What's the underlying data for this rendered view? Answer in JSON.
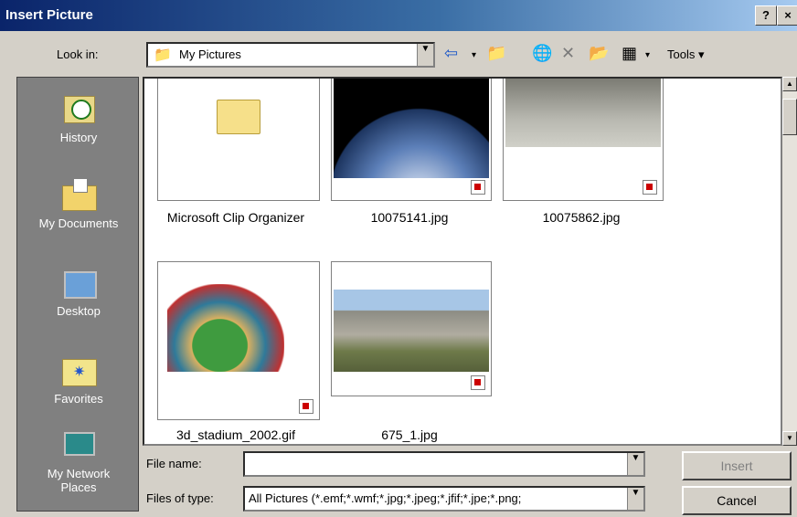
{
  "window": {
    "title": "Insert Picture",
    "help": "?",
    "close": "×"
  },
  "lookin": {
    "label": "Look in:",
    "value": "My Pictures"
  },
  "toolbar": {
    "tools_label": "Tools ▾"
  },
  "places": [
    {
      "label": "History"
    },
    {
      "label": "My Documents"
    },
    {
      "label": "Desktop"
    },
    {
      "label": "Favorites"
    },
    {
      "label": "My Network Places"
    }
  ],
  "files": [
    {
      "name": "Microsoft Clip Organizer"
    },
    {
      "name": "10075141.jpg"
    },
    {
      "name": "10075862.jpg"
    },
    {
      "name": "3d_stadium_2002.gif"
    },
    {
      "name": "675_1.jpg"
    }
  ],
  "footer": {
    "filename_label": "File name:",
    "filename_value": "",
    "filetype_label": "Files of type:",
    "filetype_value": "All Pictures (*.emf;*.wmf;*.jpg;*.jpeg;*.jfif;*.jpe;*.png;",
    "insert_label": "Insert",
    "cancel_label": "Cancel"
  }
}
